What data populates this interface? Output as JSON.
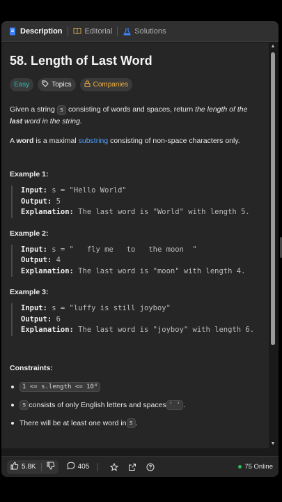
{
  "tabs": [
    {
      "label": "Description",
      "icon": "document-icon",
      "active": true
    },
    {
      "label": "Editorial",
      "icon": "book-icon",
      "active": false
    },
    {
      "label": "Solutions",
      "icon": "flask-icon",
      "active": false
    }
  ],
  "problem": {
    "title": "58. Length of Last Word",
    "tags": {
      "difficulty": "Easy",
      "topics": "Topics",
      "companies": "Companies"
    },
    "desc1": {
      "pre": "Given a string ",
      "code": "s",
      "mid": " consisting of words and spaces, return ",
      "em": "the length of the ",
      "em_bold": "last",
      "em_post": " word in the string."
    },
    "desc2": {
      "pre": "A ",
      "bold": "word",
      "mid": " is a maximal ",
      "link": "substring",
      "post": " consisting of non-space characters only."
    }
  },
  "examples": [
    {
      "title": "Example 1:",
      "input_label": "Input:",
      "input": " s = \"Hello World\"",
      "output_label": "Output:",
      "output": " 5",
      "expl_label": "Explanation:",
      "expl": " The last word is \"World\" with length 5."
    },
    {
      "title": "Example 2:",
      "input_label": "Input:",
      "input": " s = \"   fly me   to   the moon  \"",
      "output_label": "Output:",
      "output": " 4",
      "expl_label": "Explanation:",
      "expl": " The last word is \"moon\" with length 4."
    },
    {
      "title": "Example 3:",
      "input_label": "Input:",
      "input": " s = \"luffy is still joyboy\"",
      "output_label": "Output:",
      "output": " 6",
      "expl_label": "Explanation:",
      "expl": " The last word is \"joyboy\" with length 6."
    }
  ],
  "constraints": {
    "title": "Constraints:",
    "c1": "1 <= s.length <= 10⁴",
    "c2_code": "s",
    "c2_text": " consists of only English letters and spaces ",
    "c2_code2": "' '",
    "c2_end": ".",
    "c3_text": "There will be at least one word in ",
    "c3_code": "s",
    "c3_end": "."
  },
  "bottom": {
    "likes": "5.8K",
    "comments": "405",
    "online": "75 Online"
  },
  "colors": {
    "easy": "#2cbbb0",
    "companies": "#f0b040",
    "link": "#4ea1ff",
    "online_dot": "#2cbb5d"
  }
}
